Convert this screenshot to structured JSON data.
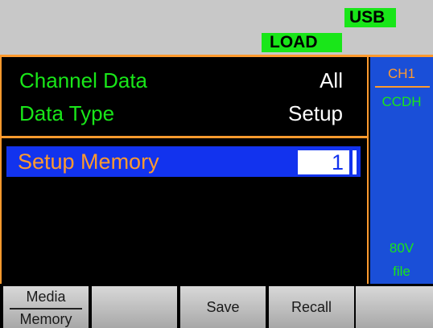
{
  "status": {
    "usb_label": "USB",
    "load_label": "LOAD"
  },
  "settings": {
    "channel_data_label": "Channel Data",
    "channel_data_value": "All",
    "data_type_label": "Data Type",
    "data_type_value": "Setup",
    "setup_memory_label": "Setup Memory",
    "setup_memory_value": "1"
  },
  "sidebar": {
    "channel": "CH1",
    "mode": "CCDH",
    "voltage": "80V",
    "file": "file"
  },
  "softkeys": {
    "media_top": "Media",
    "media_bottom": "Memory",
    "key2": "",
    "save": "Save",
    "recall": "Recall",
    "key5": ""
  },
  "colors": {
    "accent_green": "#19e619",
    "accent_orange": "#ff9a2e",
    "panel_blue": "#1a4fd8",
    "highlight_blue": "#1233ee"
  }
}
